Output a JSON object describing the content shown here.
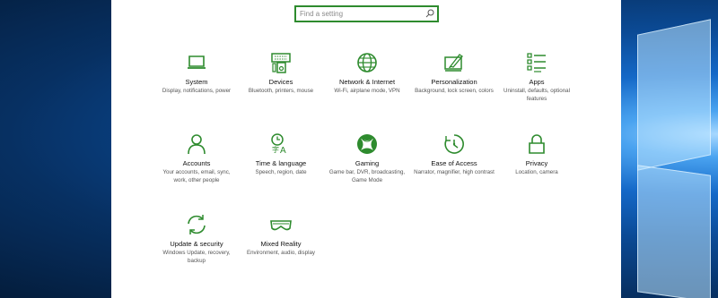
{
  "search": {
    "placeholder": "Find a setting"
  },
  "tiles": [
    {
      "title": "System",
      "desc": "Display, notifications, power",
      "icon": "laptop-icon"
    },
    {
      "title": "Devices",
      "desc": "Bluetooth, printers, mouse",
      "icon": "keyboard-speaker-icon"
    },
    {
      "title": "Network & Internet",
      "desc": "Wi-Fi, airplane mode, VPN",
      "icon": "globe-icon"
    },
    {
      "title": "Personalization",
      "desc": "Background, lock screen, colors",
      "icon": "paint-monitor-icon"
    },
    {
      "title": "Apps",
      "desc": "Uninstall, defaults, optional features",
      "icon": "apps-list-icon"
    },
    {
      "title": "Accounts",
      "desc": "Your accounts, email, sync, work, other people",
      "icon": "person-icon"
    },
    {
      "title": "Time & language",
      "desc": "Speech, region, date",
      "icon": "time-language-icon"
    },
    {
      "title": "Gaming",
      "desc": "Game bar, DVR, broadcasting, Game Mode",
      "icon": "xbox-icon"
    },
    {
      "title": "Ease of Access",
      "desc": "Narrator, magnifier, high contrast",
      "icon": "ease-of-access-icon"
    },
    {
      "title": "Privacy",
      "desc": "Location, camera",
      "icon": "lock-icon"
    },
    {
      "title": "Update & security",
      "desc": "Windows Update, recovery, backup",
      "icon": "sync-arrows-icon"
    },
    {
      "title": "Mixed Reality",
      "desc": "Environment, audio, display",
      "icon": "headset-icon"
    }
  ],
  "colors": {
    "accent": "#2e8b2e",
    "panel": "#ffffff"
  }
}
